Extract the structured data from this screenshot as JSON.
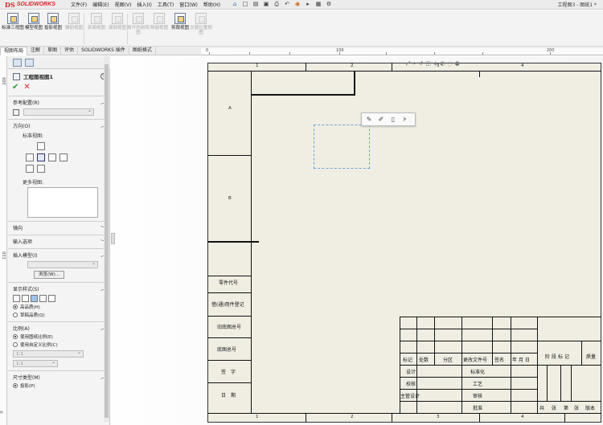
{
  "app": {
    "logo_ds": "DS",
    "logo_text": "SOLIDWORKS",
    "document_title": "工程图3 - 图纸1 *"
  },
  "menu": [
    "文件(F)",
    "编辑(E)",
    "视图(V)",
    "插入(I)",
    "工具(T)",
    "窗口(W)",
    "帮助(H)"
  ],
  "quick_access": [
    "home-icon",
    "new-icon",
    "open-icon",
    "save-icon",
    "print-icon",
    "undo-icon",
    "rebuild-icon",
    "select-icon",
    "file-props-icon",
    "options-icon"
  ],
  "ribbon": [
    {
      "label": "标准三视图",
      "enabled": true
    },
    {
      "label": "模型视图",
      "enabled": true
    },
    {
      "label": "投影视图",
      "enabled": true
    },
    {
      "label": "辅助视图",
      "enabled": false
    },
    {
      "label": "剖面视图",
      "enabled": false
    },
    {
      "label": "局部视图",
      "enabled": false
    },
    {
      "label": "断开的剖视图",
      "enabled": false
    },
    {
      "label": "断裂视图",
      "enabled": false
    },
    {
      "label": "剪裁视图",
      "enabled": true
    },
    {
      "label": "交替位置视图",
      "enabled": false
    }
  ],
  "tabs": [
    "视图布局",
    "注解",
    "草图",
    "评估",
    "SOLIDWORKS 插件",
    "图纸格式"
  ],
  "active_tab": "视图布局",
  "ruler": {
    "h_labels": [
      "0",
      "100",
      "200"
    ],
    "v_labels": [
      "200",
      "110",
      "0"
    ]
  },
  "property_manager": {
    "title": "工程图视图1",
    "help": "?",
    "groups": {
      "ref_config": {
        "label": "参考配置(R)"
      },
      "orientation": {
        "label": "方向(O)",
        "standard_views": "标准视图:",
        "more_views": "更多视图:"
      },
      "mirror": {
        "label": "镜向"
      },
      "import": {
        "label": "输入选项"
      },
      "insert_model": {
        "label": "插入模型(I)",
        "browse": "浏览(W)..."
      },
      "display_style": {
        "label": "显示样式(S)",
        "opt_high": "高品质(H)",
        "opt_draft": "草稿品质(Q)"
      },
      "scale": {
        "label": "比例(A)",
        "opt_sheet": "使用图纸比例(E)",
        "opt_custom": "使用自定义比例(C)",
        "value1": "1:1",
        "value2": "1:1"
      },
      "dim_type": {
        "label": "尺寸类型(M)",
        "opt_proj": "投影(P)"
      }
    }
  },
  "sheet": {
    "zones_top": [
      "1",
      "2",
      "3",
      "4"
    ],
    "zones_bottom": [
      "1",
      "2",
      "3",
      "4"
    ],
    "zones_left": [
      "A",
      "B"
    ],
    "left_table": [
      "零件代号",
      "借(通)用件登记",
      "旧底图总号",
      "底图总号",
      "签字",
      "日期"
    ],
    "title_block": {
      "h_mark": "标记",
      "h_qty": "处数",
      "h_zone": "分区",
      "h_docno": "更改文件号",
      "h_sign": "签名",
      "h_date": "年 月 日",
      "design": "设计",
      "std": "标准化",
      "check": "校核",
      "craft": "工艺",
      "chief": "主管设计",
      "review": "审核",
      "approve": "批准",
      "stage": "阶段标记",
      "weight": "质量",
      "footer": [
        "共",
        "张",
        "第",
        "张",
        "版本"
      ]
    }
  },
  "context_toolbar": [
    "view-props-icon",
    "edit-sketch-icon",
    "layer-icon",
    "align-icon"
  ]
}
